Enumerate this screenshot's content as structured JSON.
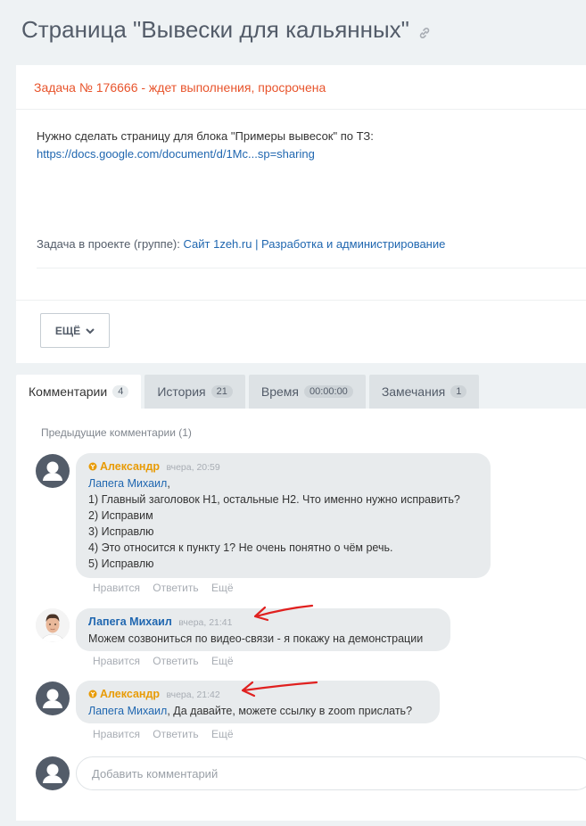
{
  "page": {
    "title": "Страница \"Вывески для кальянных\""
  },
  "task": {
    "status": "Задача № 176666 - ждет выполнения, просрочена",
    "description": "Нужно сделать страницу для блока \"Примеры вывесок\" по ТЗ:",
    "link": "https://docs.google.com/document/d/1Mc...sp=sharing",
    "project_label": "Задача в проекте (группе):",
    "project_link": "Сайт 1zeh.ru | Разработка и администрирование",
    "more_label": "ЕЩЁ"
  },
  "tabs": [
    {
      "label": "Комментарии",
      "badge": "4"
    },
    {
      "label": "История",
      "badge": "21"
    },
    {
      "label": "Время",
      "badge": "00:00:00"
    },
    {
      "label": "Замечания",
      "badge": "1"
    }
  ],
  "comments": {
    "previous_label": "Предыдущие комментарии",
    "previous_count": "(1)",
    "items": [
      {
        "author": "Александр",
        "time": "вчера, 20:59",
        "mention": "Лапега Михаил",
        "text_after_mention": ",",
        "lines": [
          "1) Главный заголовок Н1, остальные Н2. Что именно нужно исправить?",
          "2) Исправим",
          "3) Исправлю",
          "4) Это относится к пункту 1? Не очень понятно о чём речь.",
          "5) Исправлю"
        ]
      },
      {
        "author": "Лапега Михаил",
        "time": "вчера, 21:41",
        "text": "Можем созвониться по видео-связи - я покажу на демонстрации"
      },
      {
        "author": "Александр",
        "time": "вчера, 21:42",
        "mention": "Лапега Михаил",
        "text_after_mention": ", Да давайте, можете ссылку в zoom прислать?"
      }
    ],
    "actions": {
      "like": "Нравится",
      "reply": "Ответить",
      "more": "Ещё"
    },
    "add_placeholder": "Добавить комментарий"
  },
  "colors": {
    "accent_blue": "#2067b0",
    "status_red": "#e8542c",
    "external_user": "#e89b06",
    "annotation_arrow": "#e0201f"
  }
}
